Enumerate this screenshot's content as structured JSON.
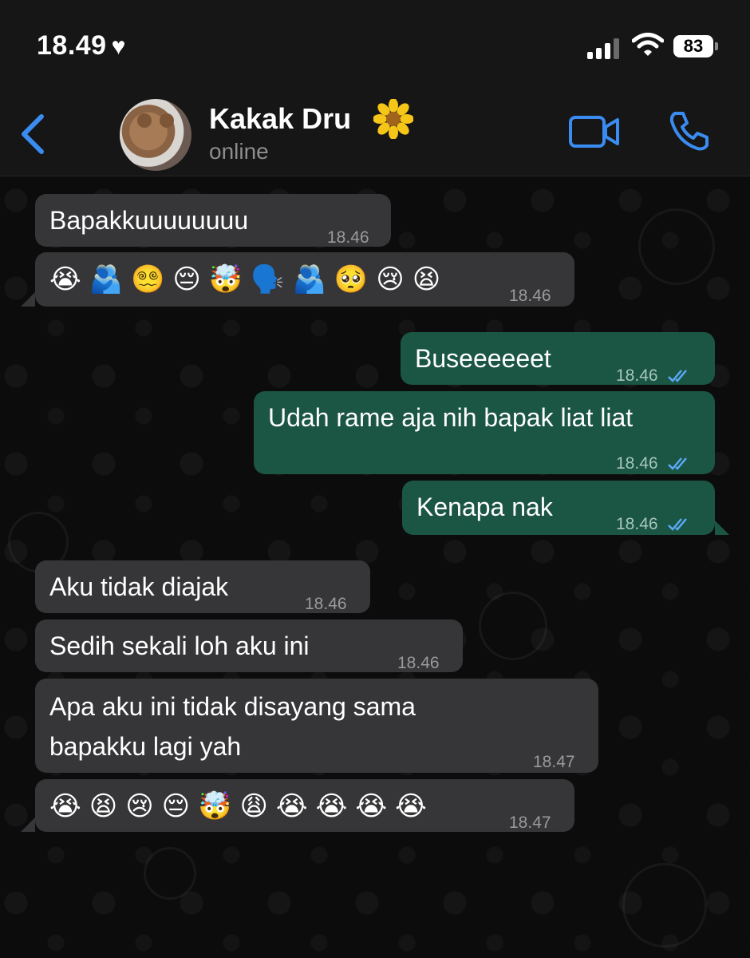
{
  "status_bar": {
    "time": "18.49",
    "heart": "♥",
    "battery": "83",
    "icons": [
      "signal-icon",
      "wifi-icon",
      "battery-icon"
    ]
  },
  "header": {
    "contact_name": "Kakak Dru",
    "status": "online",
    "icons": [
      "back-chevron-icon",
      "sunflower-icon",
      "video-call-icon",
      "phone-icon"
    ],
    "accent_color": "#3a8cf0"
  },
  "colors": {
    "incoming_bubble": "#363638",
    "outgoing_bubble": "#1b5543",
    "read_ticks": "#5aa9f5"
  },
  "messages": [
    {
      "dir": "in",
      "text": "Bapakkuuuuuuuu",
      "time": "18.46"
    },
    {
      "dir": "in",
      "emojis": [
        "😭",
        "🫂",
        "😵‍💫",
        "😔",
        "🤯",
        "🗣️",
        "🫂",
        "🥺",
        "😢",
        "😫"
      ],
      "time": "18.46"
    },
    {
      "dir": "out",
      "text": "Buseeeeeet",
      "time": "18.46"
    },
    {
      "dir": "out",
      "text": "Udah rame aja nih bapak liat liat",
      "time": "18.46"
    },
    {
      "dir": "out",
      "text": "Kenapa nak",
      "time": "18.46"
    },
    {
      "dir": "in",
      "text": "Aku tidak diajak",
      "time": "18.46"
    },
    {
      "dir": "in",
      "text": "Sedih sekali loh aku ini",
      "time": "18.46"
    },
    {
      "dir": "in",
      "lines": [
        "Apa aku ini tidak disayang sama",
        "bapakku lagi yah"
      ],
      "time": "18.47"
    },
    {
      "dir": "in",
      "emojis": [
        "😭",
        "😫",
        "😢",
        "😔",
        "🤯",
        "😩",
        "😭",
        "😭",
        "😭",
        "😭"
      ],
      "time": "18.47"
    }
  ]
}
